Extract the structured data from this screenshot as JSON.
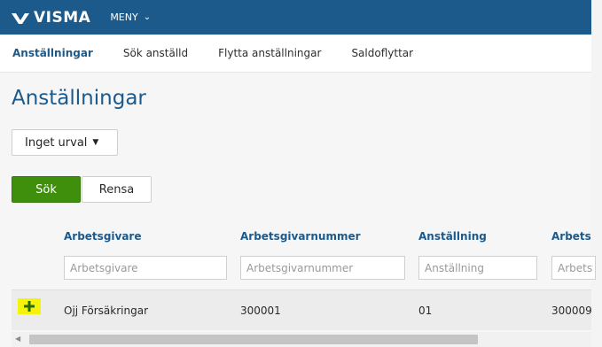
{
  "header": {
    "logo_text": "VISMA",
    "menu_label": "MENY",
    "brand_color": "#1c5a8c"
  },
  "tabs": [
    {
      "label": "Anställningar",
      "active": true
    },
    {
      "label": "Sök anställd",
      "active": false
    },
    {
      "label": "Flytta anställningar",
      "active": false
    },
    {
      "label": "Saldoflyttar",
      "active": false
    }
  ],
  "page": {
    "title": "Anställningar",
    "filter_dropdown": "Inget urval",
    "search_button": "Sök",
    "clear_button": "Rensa"
  },
  "table": {
    "columns": [
      {
        "header": "Arbetsgivare",
        "placeholder": "Arbetsgivare"
      },
      {
        "header": "Arbetsgivarnummer",
        "placeholder": "Arbetsgivarnummer"
      },
      {
        "header": "Anställning",
        "placeholder": "Anställning"
      },
      {
        "header": "Arbetst",
        "placeholder": "Arbetst"
      }
    ],
    "rows": [
      {
        "cells": [
          "Ojj Försäkringar",
          "300001",
          "01",
          "300009"
        ],
        "expand_icon": "plus-icon"
      }
    ]
  },
  "colors": {
    "accent": "#1c5a8c",
    "search_button": "#3f8f0d",
    "expand_highlight": "#f4f40a"
  }
}
